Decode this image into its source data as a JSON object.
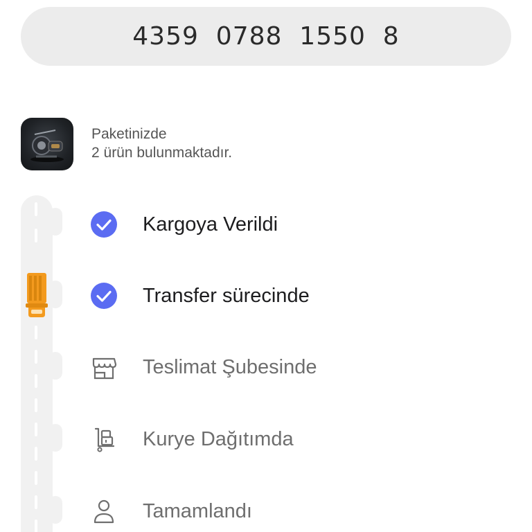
{
  "tracking": {
    "number": "4359  0788  1550  8"
  },
  "package": {
    "title": "Paketinizde",
    "count_text": "2 ürün bulunmaktadır."
  },
  "steps": [
    {
      "label": "Kargoya Verildi",
      "status": "done",
      "icon": "check-circle-icon"
    },
    {
      "label": "Transfer sürecinde",
      "status": "done",
      "icon": "check-circle-icon"
    },
    {
      "label": "Teslimat Şubesinde",
      "status": "pending",
      "icon": "store-icon"
    },
    {
      "label": "Kurye Dağıtımda",
      "status": "pending",
      "icon": "delivery-cart-icon"
    },
    {
      "label": "Tamamlandı",
      "status": "pending",
      "icon": "person-icon"
    }
  ],
  "colors": {
    "accent": "#5b6cf2",
    "truck": "#f39a1e",
    "pending_icon": "#6e6e6e"
  }
}
